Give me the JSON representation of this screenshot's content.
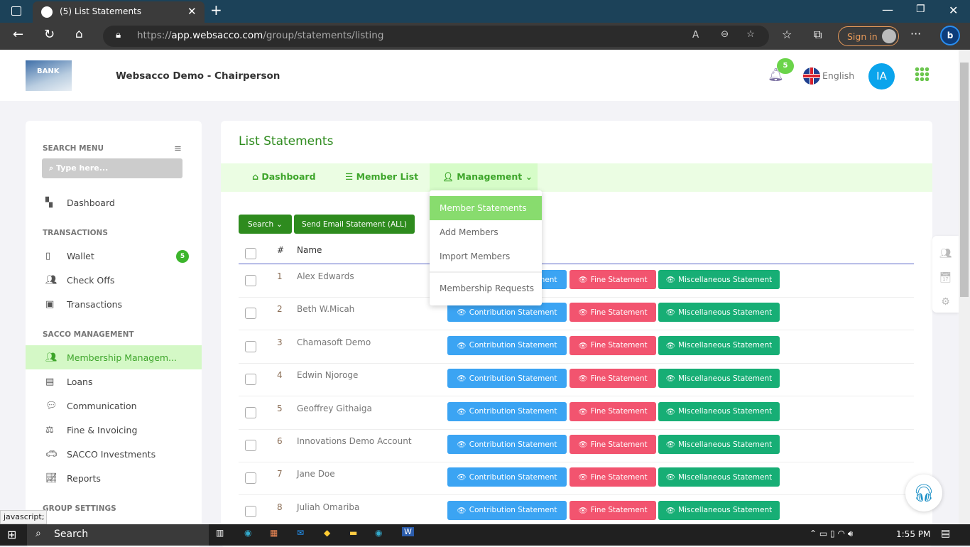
{
  "browser": {
    "tab_title": "(5) List Statements",
    "url_prefix": "https://",
    "url_domain": "app.websacco.com",
    "url_path": "/group/statements/listing",
    "sign_in": "Sign in"
  },
  "header": {
    "org_title": "Websacco Demo - Chairperson",
    "notification_count": "5",
    "language": "English",
    "avatar_initials": "IA",
    "logo_text": "BANK"
  },
  "sidebar": {
    "search_label": "SEARCH MENU",
    "search_placeholder": "Type here...",
    "dashboard": "Dashboard",
    "sections": {
      "transactions": "TRANSACTIONS",
      "sacco": "SACCO MANAGEMENT",
      "group": "GROUP SETTINGS"
    },
    "transactions": [
      {
        "label": "Wallet",
        "badge": "5"
      },
      {
        "label": "Check Offs"
      },
      {
        "label": "Transactions"
      }
    ],
    "sacco": [
      {
        "label": "Membership Managem..."
      },
      {
        "label": "Loans"
      },
      {
        "label": "Communication"
      },
      {
        "label": "Fine & Invoicing"
      },
      {
        "label": "SACCO Investments"
      },
      {
        "label": "Reports"
      }
    ]
  },
  "main": {
    "title": "List Statements",
    "nav": [
      "Dashboard",
      "Member List",
      "Management"
    ],
    "dropdown": [
      "Member Statements",
      "Add Members",
      "Import Members",
      "Membership Requests"
    ],
    "search_btn": "Search",
    "email_btn": "Send Email Statement (ALL)",
    "columns": {
      "num": "#",
      "name": "Name"
    },
    "buttons": {
      "contribution": "Contribution Statement",
      "fine": "Fine Statement",
      "misc": "Miscellaneous Statement"
    },
    "rows": [
      {
        "n": "1",
        "name": "Alex Edwards"
      },
      {
        "n": "2",
        "name": "Beth W.Micah"
      },
      {
        "n": "3",
        "name": "Chamasoft Demo"
      },
      {
        "n": "4",
        "name": "Edwin Njoroge"
      },
      {
        "n": "5",
        "name": "Geoffrey Githaiga"
      },
      {
        "n": "6",
        "name": "Innovations Demo Account"
      },
      {
        "n": "7",
        "name": "Jane Doe"
      },
      {
        "n": "8",
        "name": "Juliah Omariba"
      }
    ]
  },
  "status_tooltip": "javascript;",
  "taskbar": {
    "search": "Search",
    "time": "1:55 PM"
  },
  "colors": {
    "green": "#2e8b1e",
    "light_green": "#88dc6e",
    "blue": "#3ba4f3",
    "red": "#f2546f",
    "teal": "#17ae75"
  }
}
